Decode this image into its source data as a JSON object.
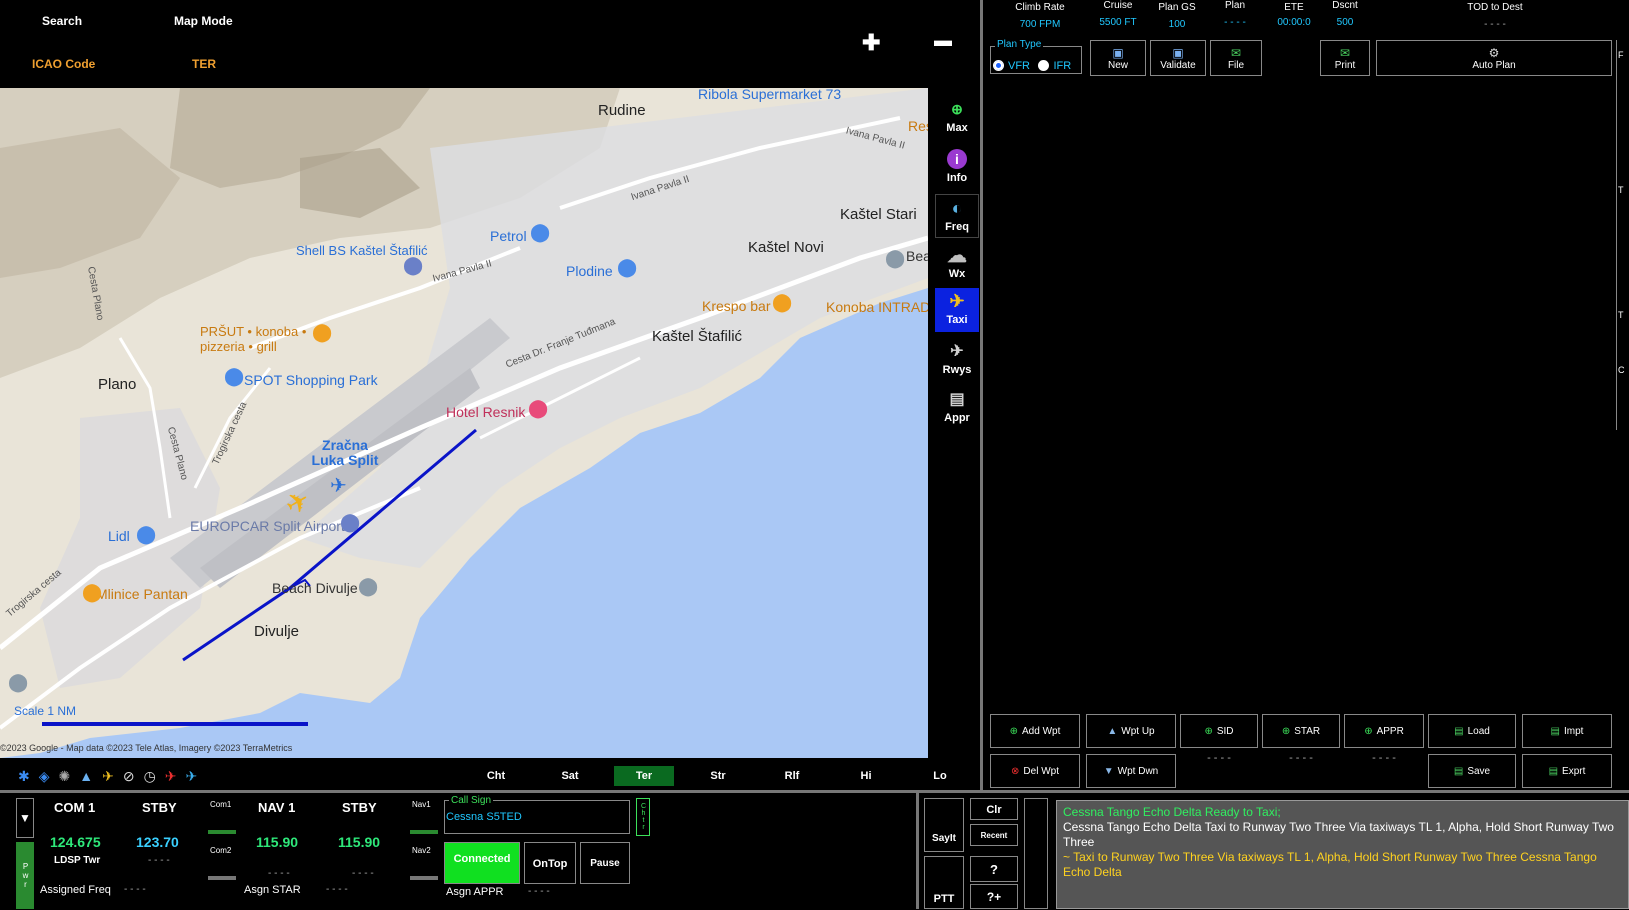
{
  "top_left": {
    "search_label": "Search",
    "map_mode_label": "Map Mode",
    "icao_label": "ICAO Code",
    "map_mode_value": "TER",
    "zoom_in": "✚",
    "zoom_out": "▬"
  },
  "map": {
    "places": [
      "Rudine",
      "Ribola Supermarket 73",
      "Ivana Pavla II",
      "Ivana Pavla II",
      "Petrol",
      "Shell BS Kaštel Štafilić",
      "Ivana Pavla II",
      "Plodine",
      "Kaštel Stari",
      "Kaštel Novi",
      "Krespo bar",
      "Konoba INTRADA",
      "Kaštel Štafilić",
      "Cesta Dr. Franje Tuđmana",
      "PRŠUT • konoba • pizzeria • grill",
      "SPOT Shopping Park",
      "Plano",
      "Hotel Resnik",
      "Zračna Luka Split",
      "EUROPCAR Split Airport",
      "Lidl",
      "Mlinice Pantan",
      "Beach Divulje",
      "Divulje",
      "Cesta Plano",
      "Trogirska cesta",
      "Cesta Plano",
      "Trogirska cesta",
      "Res",
      "Bea"
    ],
    "scale_label": "Scale 1 NM",
    "copyright": "©2023 Google - Map data ©2023 Tele Atlas, Imagery ©2023 TerraMetrics",
    "route_color": "#0a14c8"
  },
  "side_buttons": [
    {
      "label": "Max",
      "icon": "plus-circle-icon"
    },
    {
      "label": "Info",
      "icon": "info-icon"
    },
    {
      "label": "Freq",
      "icon": "freq-icon"
    },
    {
      "label": "Wx",
      "icon": "weather-icon"
    },
    {
      "label": "Taxi",
      "icon": "taxi-icon",
      "active": true
    },
    {
      "label": "Rwys",
      "icon": "runway-icon"
    },
    {
      "label": "Appr",
      "icon": "approach-icon"
    }
  ],
  "map_tabs": [
    "Cht",
    "Sat",
    "Ter",
    "Str",
    "Rlf",
    "Hi",
    "Lo"
  ],
  "active_map_tab": "Ter",
  "flight_plan": {
    "columns": [
      {
        "label": "Climb Rate",
        "value": "700 FPM"
      },
      {
        "label": "Cruise",
        "value": "5500 FT"
      },
      {
        "label": "Plan GS",
        "value": "100"
      },
      {
        "label": "Plan",
        "value": "- - - -"
      },
      {
        "label": "ETE",
        "value": "00:00:0"
      },
      {
        "label": "Dscnt",
        "value": "500"
      },
      {
        "label": "TOD to Dest",
        "value": "- - - -"
      }
    ],
    "plan_type_label": "Plan Type",
    "vfr": "VFR",
    "ifr": "IFR",
    "buttons": {
      "new": "New",
      "validate": "Validate",
      "file": "File",
      "print": "Print",
      "auto_plan": "Auto Plan"
    }
  },
  "waypoint_buttons": {
    "add_wpt": "Add Wpt",
    "wpt_up": "Wpt Up",
    "sid": "SID",
    "star": "STAR",
    "appr": "APPR",
    "load": "Load",
    "impt": "Impt",
    "del_wpt": "Del Wpt",
    "wpt_dwn": "Wpt Dwn",
    "save": "Save",
    "exprt": "Exprt",
    "sid_value": "- - - -",
    "star_value": "- - - -",
    "appr_value": "- - - -"
  },
  "radio": {
    "com1_label": "COM 1",
    "stby_label": "STBY",
    "com1_active": "124.675",
    "com1_stby": "123.70",
    "com1_name": "LDSP Twr",
    "com1_stby_name": "- - - -",
    "com1_small": "Com1",
    "com2_small": "Com2",
    "nav1_label": "NAV 1",
    "nav_stby_label": "STBY",
    "nav1_active": "115.90",
    "nav1_stby": "115.90",
    "nav1_name": "- - - -",
    "nav1_stby_name": "- - - -",
    "nav1_small": "Nav1",
    "nav2_small": "Nav2",
    "assigned_freq_label": "Assigned Freq",
    "assigned_freq_value": "- - - -",
    "asgn_star_label": "Asgn STAR",
    "asgn_star_value": "- - - -",
    "asgn_appr_label": "Asgn APPR",
    "asgn_appr_value": "- - - -",
    "pwr": "Pwr",
    "call_sign_label": "Call Sign",
    "call_sign_value": "Cessna S5TED",
    "chtr": "Chtr",
    "connected": "Connected",
    "on_top": "OnTop",
    "pause": "Pause"
  },
  "atc_buttons": {
    "sayit": "SayIt",
    "ptt": "PTT",
    "clr": "Clr",
    "recent": "Recent",
    "help": "?",
    "help_plus": "?+"
  },
  "atc_log": [
    {
      "text": "Cessna Tango Echo Delta Ready to Taxi;",
      "color": "#30f060"
    },
    {
      "text": "Cessna Tango Echo Delta  Taxi to Runway Two Three Via taxiways TL 1, Alpha,  Hold Short Runway Two Three",
      "color": "#ffffff"
    },
    {
      "text": "~ Taxi to Runway Two Three Via taxiways TL 1, Alpha,  Hold Short Runway Two Three Cessna Tango Echo Delta",
      "color": "#ffd21f"
    }
  ],
  "right_edge_letters": [
    "F",
    "T",
    "T",
    "C"
  ]
}
